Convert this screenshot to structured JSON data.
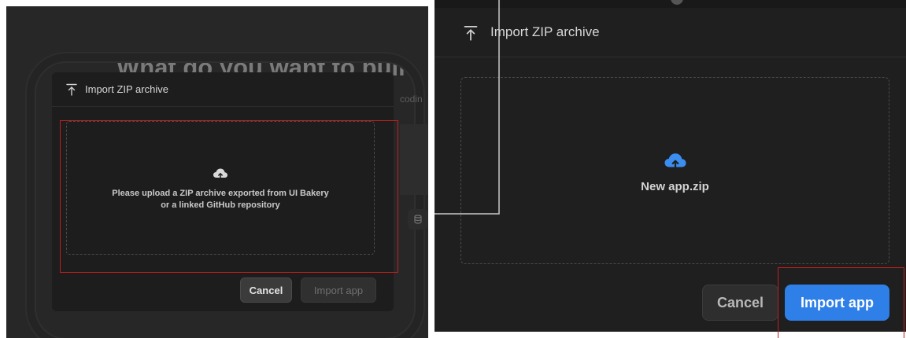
{
  "left_screen": {
    "background_heading": "What do you want to buil",
    "background_faint_text": "codin",
    "dialog": {
      "title": "Import ZIP archive",
      "title_icon": "upload-icon",
      "drop_icon": "cloud-upload-icon",
      "hint_line_1": "Please upload a ZIP archive exported from UI Bakery",
      "hint_line_2": "or a linked GitHub repository",
      "cancel_label": "Cancel",
      "import_label": "Import app",
      "import_enabled": false
    }
  },
  "right_screen": {
    "dialog": {
      "title": "Import ZIP archive",
      "title_icon": "upload-icon",
      "drop_icon": "cloud-upload-icon",
      "file_name": "New app.zip",
      "cancel_label": "Cancel",
      "import_label": "Import app",
      "import_enabled": true
    }
  },
  "colors": {
    "highlight": "#c21f1f",
    "accent_blue": "#2f7fe8",
    "modal_bg": "#1d1d1d",
    "backdrop": "#272727"
  }
}
